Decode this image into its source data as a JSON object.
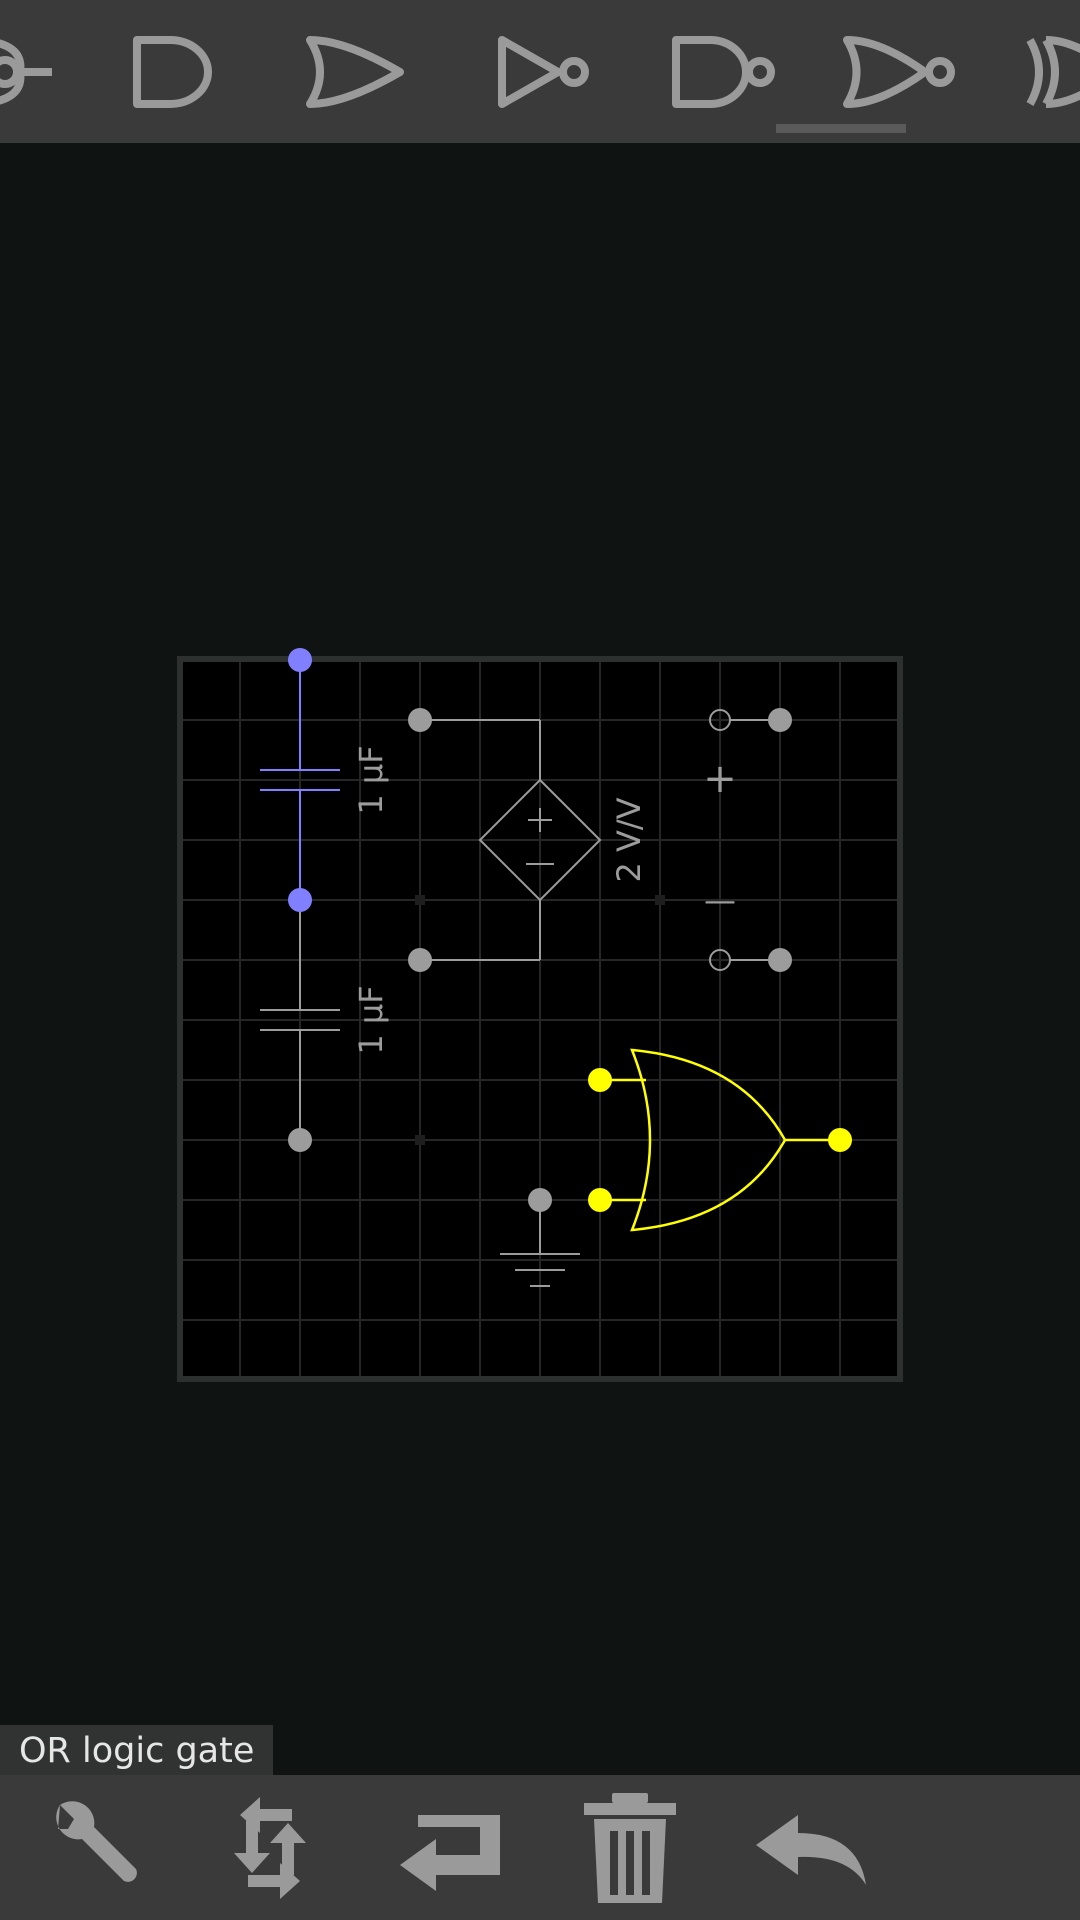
{
  "toolbar": {
    "items": [
      {
        "name": "xnor-gate-icon",
        "selected": false
      },
      {
        "name": "and-gate-icon",
        "selected": false
      },
      {
        "name": "or-gate-icon",
        "selected": false
      },
      {
        "name": "not-gate-icon",
        "selected": false
      },
      {
        "name": "nand-gate-icon",
        "selected": false
      },
      {
        "name": "nor-gate-icon",
        "selected": true
      },
      {
        "name": "xor-gate-icon",
        "selected": false
      }
    ]
  },
  "circuit": {
    "capacitor_top_label": "1 µF",
    "capacitor_bottom_label": "1 µF",
    "source_label": "2 V/V",
    "plus_sign": "+",
    "minus_sign": "—"
  },
  "colors": {
    "selected_component": "#8080ff",
    "highlighted_gate": "#ffff00",
    "component_gray": "#9c9c9c",
    "grid": "#262626"
  },
  "status": {
    "label": "OR logic gate"
  },
  "bottom_toolbar": {
    "buttons": [
      "wrench-icon",
      "rotate-icon",
      "flip-icon",
      "trash-icon",
      "undo-icon"
    ]
  }
}
